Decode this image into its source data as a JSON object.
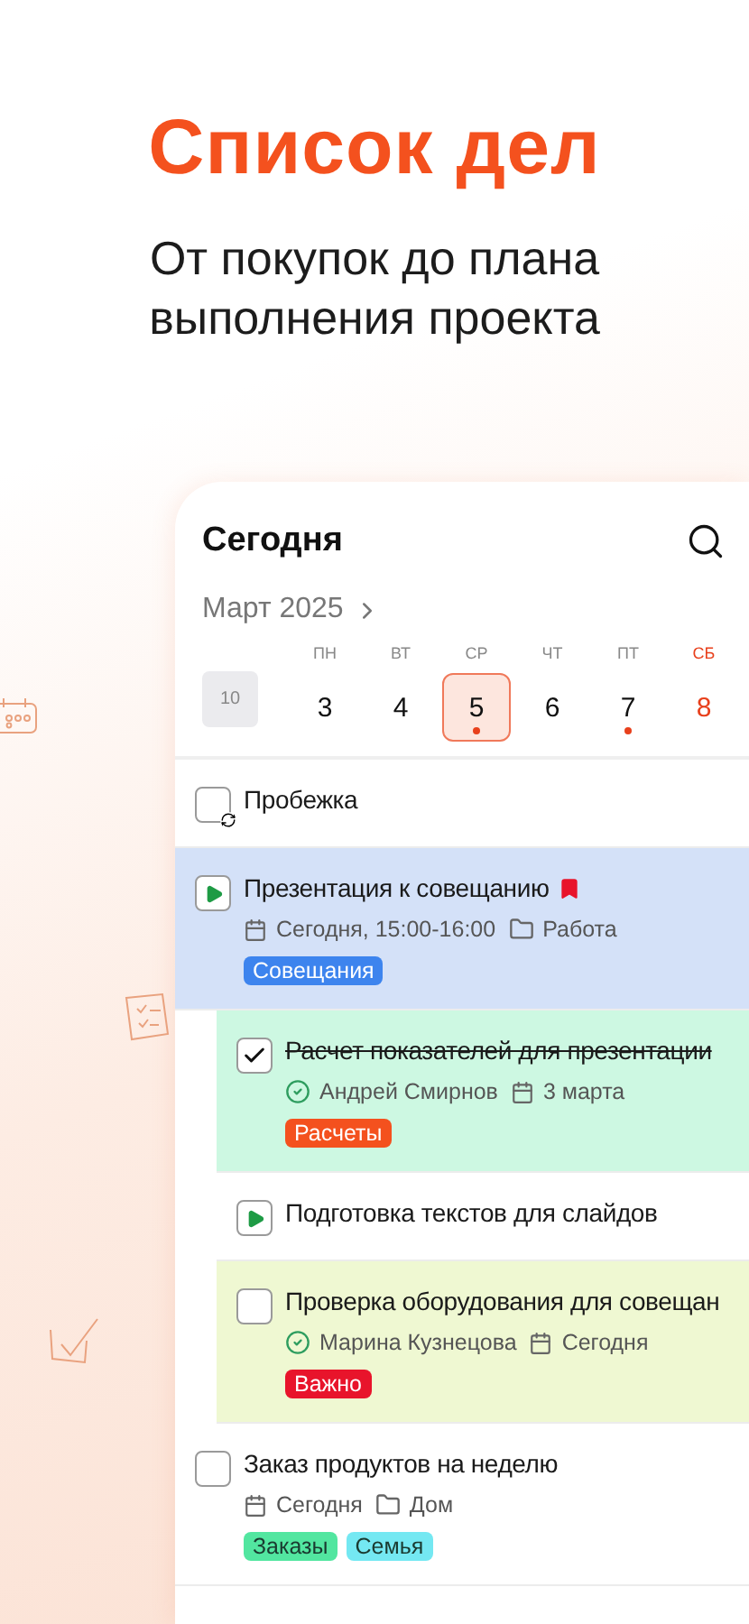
{
  "headline": "Список дел",
  "subtitle": "От покупок до плана выполнения проекта",
  "card": {
    "title": "Сегодня",
    "month": "Март 2025",
    "week": "10",
    "days": [
      {
        "weekday": "ПН",
        "number": "3",
        "selected": false,
        "dot": false,
        "weekend": false
      },
      {
        "weekday": "ВТ",
        "number": "4",
        "selected": false,
        "dot": false,
        "weekend": false
      },
      {
        "weekday": "СР",
        "number": "5",
        "selected": true,
        "dot": true,
        "weekend": false
      },
      {
        "weekday": "ЧТ",
        "number": "6",
        "selected": false,
        "dot": false,
        "weekend": false
      },
      {
        "weekday": "ПТ",
        "number": "7",
        "selected": false,
        "dot": true,
        "weekend": false
      },
      {
        "weekday": "СБ",
        "number": "8",
        "selected": false,
        "dot": false,
        "weekend": true
      }
    ],
    "tasks": [
      {
        "kind": "repeat",
        "title": "Пробежка",
        "checked": false
      },
      {
        "kind": "play",
        "title": "Презентация к совещанию",
        "flagged": true,
        "color": "#d4e1f8",
        "meta": [
          {
            "kind": "date",
            "text": "Сегодня, 15:00-16:00"
          },
          {
            "kind": "folder",
            "text": "Работа"
          }
        ],
        "tags": [
          {
            "label": "Совещания",
            "color": "#3d84ee"
          }
        ],
        "children": [
          {
            "kind": "checkbox",
            "title": "Расчет показателей для презентации",
            "checked": true,
            "color": "#cdf8e2",
            "meta": [
              {
                "kind": "assignee",
                "text": "Андрей Смирнов"
              },
              {
                "kind": "date",
                "text": "3 марта"
              }
            ],
            "tags": [
              {
                "label": "Расчеты",
                "color": "#f4511e"
              }
            ]
          },
          {
            "kind": "play",
            "title": "Подготовка текстов для слайдов"
          },
          {
            "kind": "checkbox",
            "title": "Проверка оборудования для совещан",
            "checked": false,
            "color": "#eff8d2",
            "meta": [
              {
                "kind": "assignee",
                "text": "Марина Кузнецова"
              },
              {
                "kind": "date",
                "text": "Сегодня"
              }
            ],
            "tags": [
              {
                "label": "Важно",
                "color": "#e8142b"
              }
            ]
          }
        ]
      },
      {
        "kind": "checkbox",
        "title": "Заказ продуктов на неделю",
        "checked": false,
        "meta": [
          {
            "kind": "date",
            "text": "Сегодня"
          },
          {
            "kind": "folder",
            "text": "Дом"
          }
        ],
        "tags": [
          {
            "label": "Заказы",
            "color": "#52e6a0"
          },
          {
            "label": "Семья",
            "color": "#74e8f2"
          }
        ]
      }
    ]
  }
}
